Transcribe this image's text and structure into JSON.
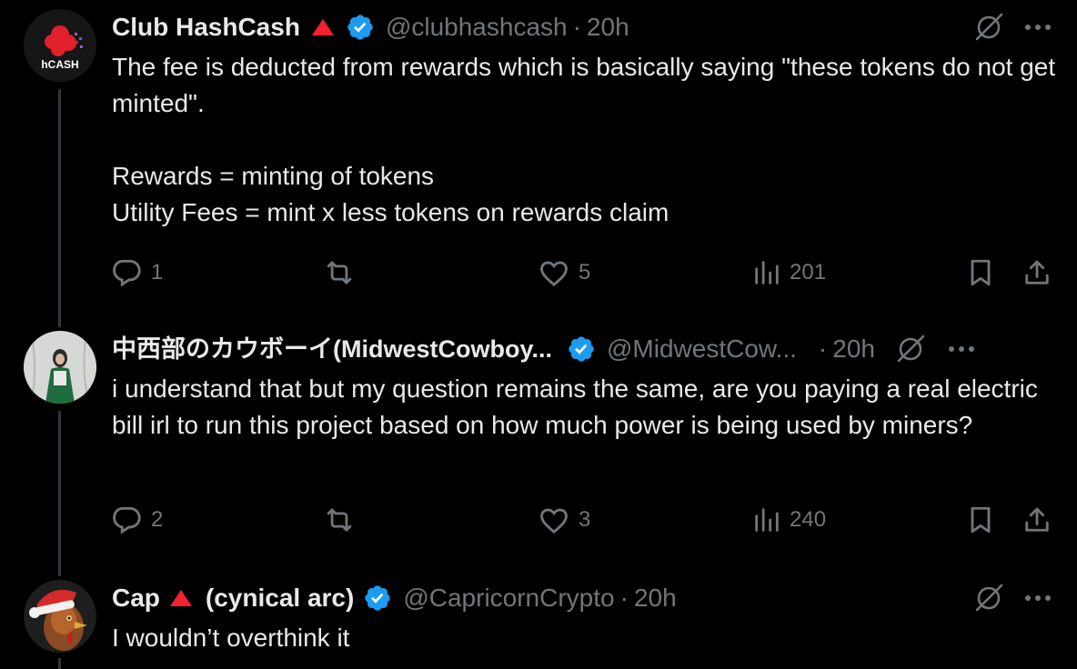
{
  "tweets": [
    {
      "avatar_label": "hCASH",
      "name": "Club HashCash",
      "handle": "@clubhashcash",
      "separator": "·",
      "time": "20h",
      "body": "The fee is deducted from rewards which is basically saying \"these tokens do not get minted\".\n\nRewards = minting of tokens\nUtility Fees = mint x less tokens on rewards claim",
      "replies": "1",
      "reposts": "",
      "likes": "5",
      "views": "201"
    },
    {
      "name": "中西部のカウボーイ(MidwestCowboy...",
      "handle": "@MidwestCow...",
      "separator": "·",
      "time": "20h",
      "body": "i understand that but my question remains the same, are you paying a real electric bill irl to run this project based on how much power is being used by miners?",
      "replies": "2",
      "reposts": "",
      "likes": "3",
      "views": "240"
    },
    {
      "name": "Cap",
      "name_suffix": "(cynical arc)",
      "handle": "@CapricornCrypto",
      "separator": "·",
      "time": "20h",
      "body": "I wouldn’t overthink it"
    }
  ],
  "icons": {
    "verified": "verified-badge-icon",
    "triangle": "red-triangle-icon",
    "grok": "grok-icon",
    "more": "more-icon",
    "reply": "reply-icon",
    "repost": "repost-icon",
    "like": "like-icon",
    "views": "views-icon",
    "bookmark": "bookmark-icon",
    "share": "share-icon"
  },
  "colors": {
    "background": "#000000",
    "text": "#e7e9ea",
    "secondary": "#71767b",
    "verified": "#1d9bf0",
    "triangle": "#f4212e"
  }
}
